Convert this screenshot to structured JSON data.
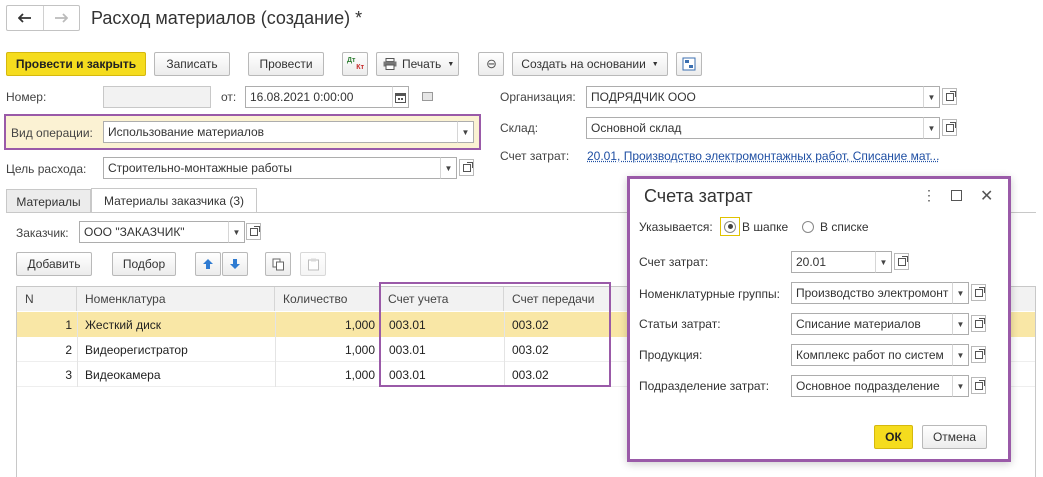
{
  "window": {
    "title": "Расход материалов (создание) *"
  },
  "toolbar": {
    "post_close": "Провести и закрыть",
    "save": "Записать",
    "post": "Провести",
    "print": "Печать",
    "create_based": "Создать на основании",
    "dtkt_top": "Дт",
    "dtkt_bottom": "Кт"
  },
  "form": {
    "number_label": "Номер:",
    "number_value": "",
    "date_label": "от:",
    "date_value": "16.08.2021  0:00:00",
    "org_label": "Организация:",
    "org_value": "ПОДРЯДЧИК ООО",
    "op_label": "Вид операции:",
    "op_value": "Использование материалов",
    "warehouse_label": "Склад:",
    "warehouse_value": "Основной склад",
    "purpose_label": "Цель расхода:",
    "purpose_value": "Строительно-монтажные работы",
    "cost_account_label": "Счет затрат:",
    "cost_account_link": "20.01, Производство электромонтажных работ, Списание мат..."
  },
  "tabs": [
    {
      "label": "Материалы"
    },
    {
      "label": "Материалы заказчика (3)"
    }
  ],
  "customer": {
    "label": "Заказчик:",
    "value": "ООО \"ЗАКАЗЧИК\""
  },
  "table_toolbar": {
    "add": "Добавить",
    "pick": "Подбор"
  },
  "table": {
    "columns": [
      "N",
      "Номенклатура",
      "Количество",
      "Счет учета",
      "Счет передачи"
    ],
    "rows": [
      {
        "n": "1",
        "name": "Жесткий диск",
        "qty": "1,000",
        "acc": "003.01",
        "transfer": "003.02"
      },
      {
        "n": "2",
        "name": "Видеорегистратор",
        "qty": "1,000",
        "acc": "003.01",
        "transfer": "003.02"
      },
      {
        "n": "3",
        "name": "Видеокамера",
        "qty": "1,000",
        "acc": "003.01",
        "transfer": "003.02"
      }
    ]
  },
  "dialog": {
    "title": "Счета затрат",
    "specified_label": "Указывается:",
    "radio_header": "В шапке",
    "radio_list": "В списке",
    "cost_account_label": "Счет затрат:",
    "cost_account_value": "20.01",
    "nomenclature_groups_label": "Номенклатурные группы:",
    "nomenclature_groups_value": "Производство электромонт",
    "cost_items_label": "Статьи затрат:",
    "cost_items_value": "Списание материалов",
    "product_label": "Продукция:",
    "product_value": "Комплекс работ по систем",
    "department_label": "Подразделение затрат:",
    "department_value": "Основное подразделение",
    "ok": "ОК",
    "cancel": "Отмена"
  }
}
